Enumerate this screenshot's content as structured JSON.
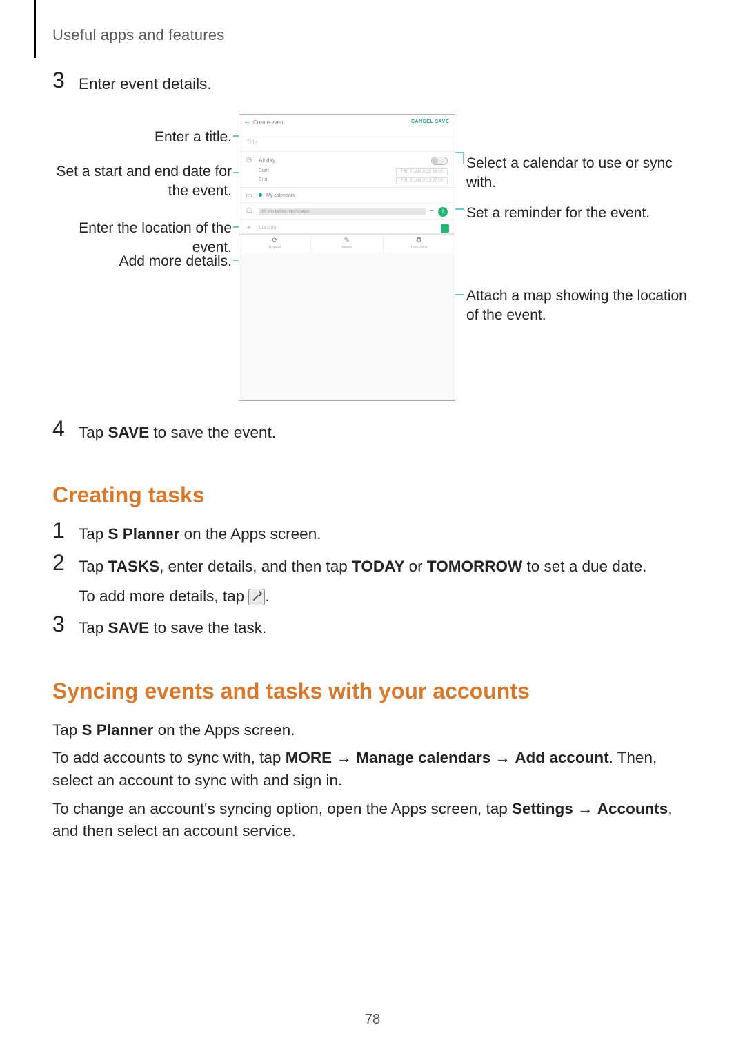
{
  "running_head": "Useful apps and features",
  "page_number": "78",
  "step3": {
    "num": "3",
    "text": "Enter event details."
  },
  "figure": {
    "left_callouts": {
      "title": "Enter a title.",
      "dates": "Set a start and end date for the event.",
      "location": "Enter the location of the event.",
      "more": "Add more details."
    },
    "right_callouts": {
      "calendar": "Select a calendar to use or sync with.",
      "reminder": "Set a reminder for the event.",
      "map": "Attach a map showing the location of the event."
    },
    "phone": {
      "header_create": "Create event",
      "header_actions": "CANCEL   SAVE",
      "title_placeholder": "Title",
      "allday_label": "All day",
      "start_label": "Start",
      "end_label": "End",
      "start_value": "FRI, 2 JAN 2015  08:00",
      "end_value": "FRI, 2 JAN 2015  07:00",
      "calendar_row": "My calendars",
      "reminder_pill": "10 min before, Notification",
      "location_placeholder": "Location",
      "more_repeat": "Repeat",
      "more_memo": "Memo",
      "more_timezone": "Time zone"
    }
  },
  "step4": {
    "num": "4",
    "pre": "Tap ",
    "bold": "SAVE",
    "post": " to save the event."
  },
  "creating_tasks": {
    "title": "Creating tasks",
    "s1": {
      "num": "1",
      "pre": "Tap ",
      "bold": "S Planner",
      "post": " on the Apps screen."
    },
    "s2": {
      "num": "2",
      "pre": "Tap ",
      "b1": "TASKS",
      "mid": ", enter details, and then tap ",
      "b2": "TODAY",
      "or": " or ",
      "b3": "TOMORROW",
      "post": " to set a due date.",
      "sub_pre": "To add more details, tap ",
      "sub_post": "."
    },
    "s3": {
      "num": "3",
      "pre": "Tap ",
      "bold": "SAVE",
      "post": " to save the task."
    }
  },
  "syncing": {
    "title": "Syncing events and tasks with your accounts",
    "p1_pre": "Tap ",
    "p1_bold": "S Planner",
    "p1_post": " on the Apps screen.",
    "p2_pre": "To add accounts to sync with, tap ",
    "p2_b1": "MORE",
    "arrow": " → ",
    "p2_b2": "Manage calendars",
    "p2_b3": "Add account",
    "p2_post": ". Then, select an account to sync with and sign in.",
    "p3_pre": "To change an account's syncing option, open the Apps screen, tap ",
    "p3_b1": "Settings",
    "p3_b2": "Accounts",
    "p3_post": ", and then select an account service."
  }
}
